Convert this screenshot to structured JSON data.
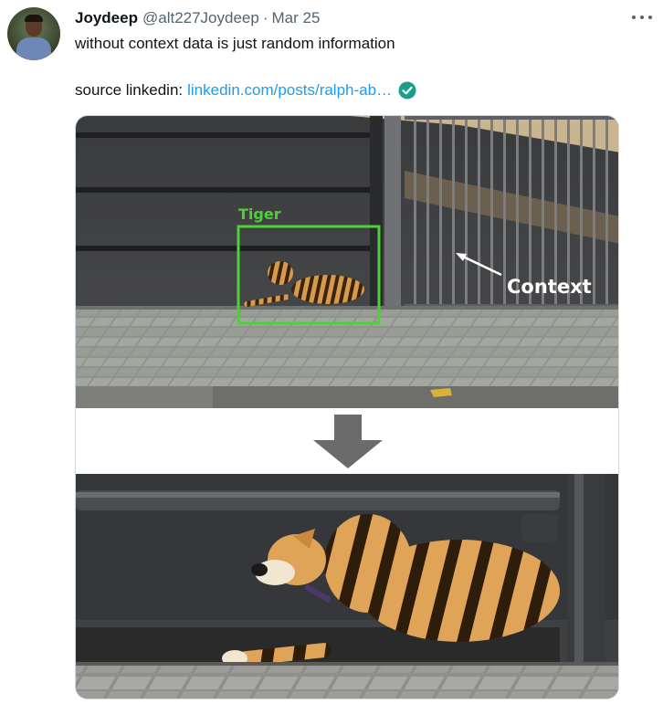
{
  "tweet": {
    "author_name": "Joydeep",
    "handle": "@alt227Joydeep",
    "separator": "·",
    "date": "Mar 25",
    "line1": "without context data is just random information",
    "source_prefix": "source linkedin:",
    "source_link": "linkedin.com/posts/ralph-ab…"
  },
  "image": {
    "label_tiger": "Tiger",
    "label_context": "Context"
  },
  "colors": {
    "link": "#1d9bf0",
    "verified_badge": "#1a9e8a",
    "tiger_box": "#4cd137"
  },
  "icons": {
    "more": "more-horizontal-icon",
    "verified": "check-circle-icon",
    "arrow": "down-arrow-icon"
  }
}
